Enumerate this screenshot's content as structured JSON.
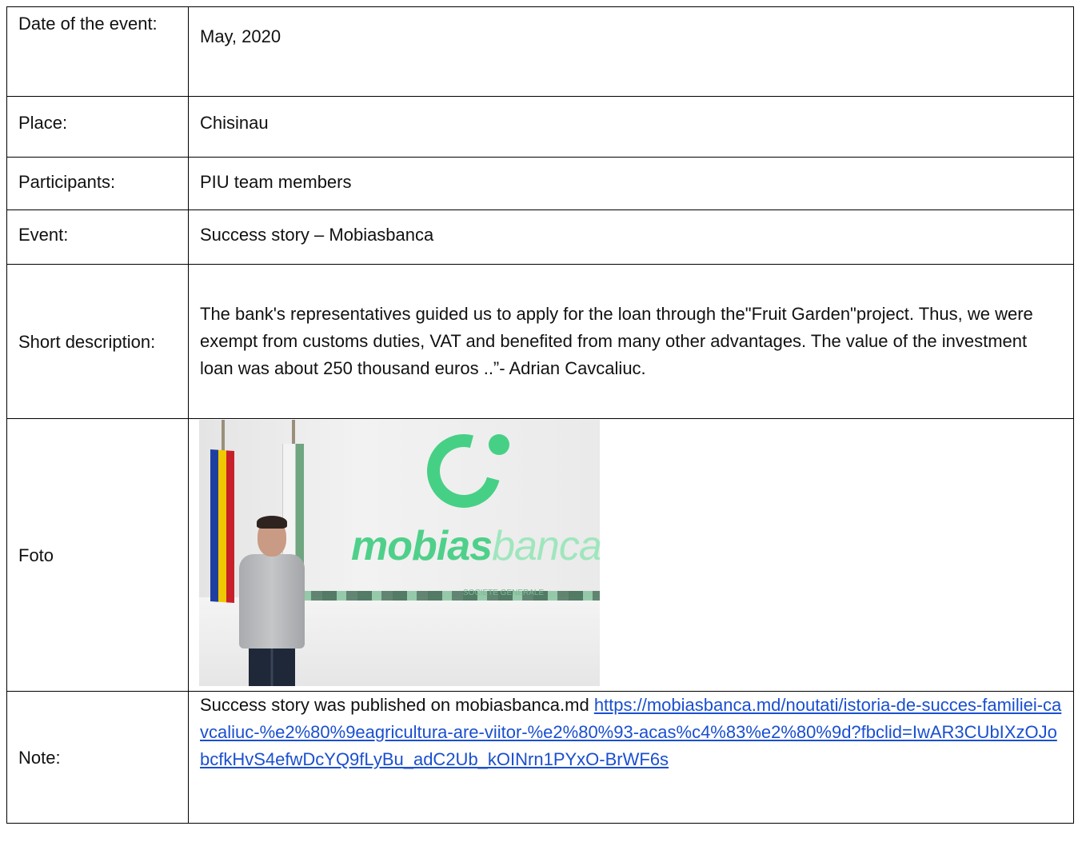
{
  "rows": {
    "date": {
      "label": "Date of the event:",
      "value": "May, 2020"
    },
    "place": {
      "label": "Place:",
      "value": "Chisinau"
    },
    "participants": {
      "label": "Participants:",
      "value": "PIU team members"
    },
    "event": {
      "label": "Event:",
      "value": "Success story – Mobiasbanca"
    },
    "description": {
      "label": "Short description:",
      "value": "The bank's representatives guided us to apply for the loan through the\"Fruit Garden\"project. Thus, we were exempt from customs duties, VAT and benefited from many other advantages. The value of the investment loan was about 250 thousand euros ..”- Adrian Cavcaliuc."
    },
    "photo": {
      "label": "Foto",
      "logo_bold": "mobias",
      "logo_light": "banca",
      "logo_sub": "SOCIETE GENERALE"
    },
    "note": {
      "label": "Note:",
      "text": "Success story was published on mobiasbanca.md ",
      "link": "https://mobiasbanca.md/noutati/istoria-de-succes-familiei-cavcaliuc-%e2%80%9eagricultura-are-viitor-%e2%80%93-acas%c4%83%e2%80%9d?fbclid=IwAR3CUbIXzOJobcfkHvS4efwDcYQ9fLyBu_adC2Ub_kOINrn1PYxO-BrWF6s"
    }
  },
  "colors": {
    "link": "#1a4fd0",
    "brand_green": "#46d085",
    "border": "#000000"
  }
}
